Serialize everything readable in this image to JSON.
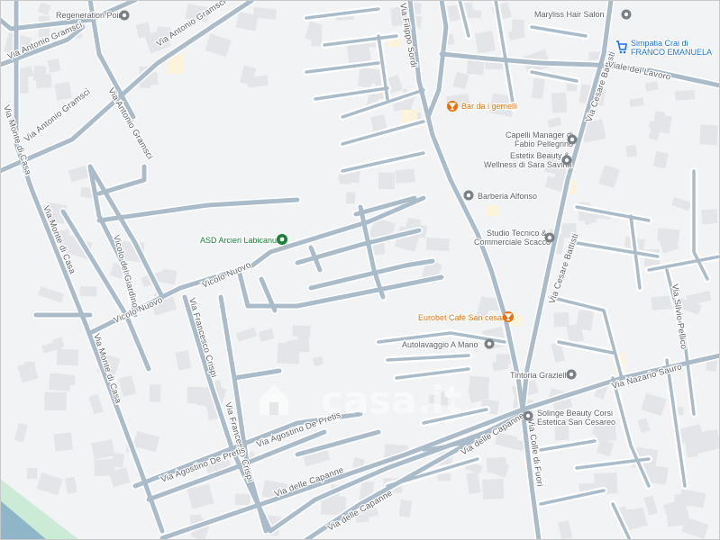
{
  "watermark": {
    "text": "casa.it",
    "icon": "house-icon"
  },
  "colors": {
    "road": "#aabcca",
    "road_halo": "#ffffff",
    "building": "#e3e5e8",
    "water": "#8fb5c9",
    "park": "#ccebd6",
    "poi_gray": "#5f6368",
    "poi_green": "#188038",
    "poi_orange": "#e8710a",
    "poi_blue": "#1a73e8"
  },
  "roads": [
    {
      "id": "via-antonio-gramsci-1",
      "name": "Via Antonio Gramsci"
    },
    {
      "id": "via-antonio-gramsci-2",
      "name": "Via Antonio Gramsci"
    },
    {
      "id": "via-antonio-gramsci-3",
      "name": "Via Antonio Gramsci"
    },
    {
      "id": "via-antonio-gramsci-4",
      "name": "Via Antonio Gramsci"
    },
    {
      "id": "via-monte-di-casa-1",
      "name": "Via Monte di Casa"
    },
    {
      "id": "via-monte-di-casa-2",
      "name": "Via Monte di Casa"
    },
    {
      "id": "via-monte-di-casa-3",
      "name": "Via Monte di Casa"
    },
    {
      "id": "vicolo-nuovo-1",
      "name": "Vicolo Nuovo"
    },
    {
      "id": "vicolo-nuovo-2",
      "name": "Vicolo Nuovo"
    },
    {
      "id": "vicolo-del-giardino",
      "name": "Vicolo del Giardino"
    },
    {
      "id": "via-francesco-crispi-1",
      "name": "Via Francesco Crispi"
    },
    {
      "id": "via-francesco-crispi-2",
      "name": "Via Francesco Crispi"
    },
    {
      "id": "via-agostino-depretis-1",
      "name": "Via Agostino De Pretis"
    },
    {
      "id": "via-agostino-depretis-2",
      "name": "Via Agostino De Pretis"
    },
    {
      "id": "via-delle-capanne-1",
      "name": "Via delle Capanne"
    },
    {
      "id": "via-delle-capanne-2",
      "name": "Via delle Capanne"
    },
    {
      "id": "via-delle-capanne-3",
      "name": "Via delle Capanne"
    },
    {
      "id": "via-colle-di-fuori",
      "name": "Via Colle di Fuori"
    },
    {
      "id": "via-cesare-battisti-1",
      "name": "Via Cesare Battisti"
    },
    {
      "id": "via-cesare-battisti-2",
      "name": "Via Cesare Battisti"
    },
    {
      "id": "via-nazario-sauro",
      "name": "Via Nazario Sauro"
    },
    {
      "id": "via-silvio-pellico",
      "name": "Via Silvio Pellico"
    },
    {
      "id": "viale-del-lavoro",
      "name": "Viale del Lavoro"
    },
    {
      "id": "via-filippo-sordi",
      "name": "Via Filippo Sordi"
    }
  ],
  "pois": [
    {
      "id": "regeneration-point",
      "label": "Regeneration Point",
      "icon": "place-icon",
      "color": "#5f6368"
    },
    {
      "id": "maryliss-hair-salon",
      "label": "Maryliss Hair Salon",
      "icon": "place-icon",
      "color": "#5f6368"
    },
    {
      "id": "simpatia-crai",
      "lines": [
        "Simpatia Crai di",
        "FRANCO EMANUELA"
      ],
      "icon": "shopping-cart-icon",
      "color": "#1a73e8"
    },
    {
      "id": "bar-da-i-gemelli",
      "label": "Bar da i gemelli",
      "icon": "cocktail-icon",
      "color": "#e8710a"
    },
    {
      "id": "capelli-manager",
      "lines": [
        "Capelli Manager di",
        "Fabio Pellegrino"
      ],
      "icon": "place-icon",
      "color": "#5f6368"
    },
    {
      "id": "estetix-beauty",
      "lines": [
        "Estetix Beauty &",
        "Wellness di Sara Savina"
      ],
      "icon": "place-icon",
      "color": "#5f6368"
    },
    {
      "id": "barberia-alfonso",
      "label": "Barberia Alfonso",
      "icon": "place-icon",
      "color": "#5f6368"
    },
    {
      "id": "studio-tecnico",
      "lines": [
        "Studio Tecnico &",
        "Commerciale Scacco"
      ],
      "icon": "place-icon",
      "color": "#5f6368"
    },
    {
      "id": "asd-arcieri",
      "label": "ASD Arcieri Labicanum",
      "icon": "park-icon",
      "color": "#188038"
    },
    {
      "id": "eurobet-cafe",
      "label": "Eurobet Café San cesareo",
      "icon": "cocktail-icon",
      "color": "#e8710a"
    },
    {
      "id": "autolavaggio",
      "label": "Autolavaggio A Mano",
      "icon": "place-icon",
      "color": "#5f6368"
    },
    {
      "id": "tintoria-graziella",
      "label": "Tintoria Graziella",
      "icon": "place-icon",
      "color": "#5f6368"
    },
    {
      "id": "solinge-beauty",
      "lines": [
        "Solinge Beauty Corsi",
        "Estetica San Cesareo"
      ],
      "icon": "place-icon",
      "color": "#5f6368"
    }
  ]
}
